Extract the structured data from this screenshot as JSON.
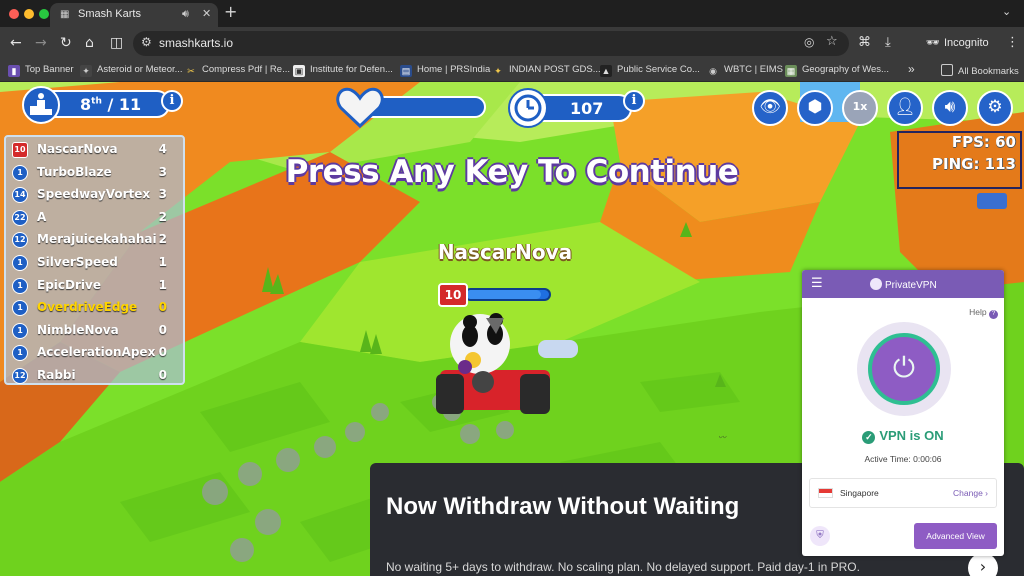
{
  "browser": {
    "tab": {
      "title": "Smash Karts"
    },
    "address": {
      "url": "smashkarts.io"
    },
    "profile": {
      "label": "Incognito"
    },
    "bookmarks": [
      "Top Banner",
      "Asteroid or Meteor...",
      "Compress Pdf | Re...",
      "Institute for Defen...",
      "Home | PRSIndia",
      "INDIAN POST GDS...",
      "Public Service Co...",
      "WBTC | EIMS",
      "Geography of Wes..."
    ],
    "overflow_label": "»",
    "all_bookmarks": "All Bookmarks"
  },
  "game": {
    "rank": {
      "value": "8",
      "suffix": "th",
      "total": "/ 11"
    },
    "timer": "107",
    "fps": "FPS: 60",
    "ping": "PING: 113",
    "speed_label": "1x",
    "prompt": "Press Any Key To Continue",
    "player_name": "NascarNova",
    "player_level": "10",
    "player_health": 0.9,
    "leaderboard": [
      {
        "level": "10",
        "name": "NascarNova",
        "score": "4",
        "badge": "red"
      },
      {
        "level": "1",
        "name": "TurboBlaze",
        "score": "3"
      },
      {
        "level": "14",
        "name": "SpeedwayVortex",
        "score": "3"
      },
      {
        "level": "22",
        "name": "A",
        "score": "2"
      },
      {
        "level": "12",
        "name": "Merajuicekahahai",
        "score": "2"
      },
      {
        "level": "1",
        "name": "SilverSpeed",
        "score": "1"
      },
      {
        "level": "1",
        "name": "EpicDrive",
        "score": "1"
      },
      {
        "level": "1",
        "name": "OverdriveEdge",
        "score": "0",
        "me": true
      },
      {
        "level": "1",
        "name": "NimbleNova",
        "score": "0"
      },
      {
        "level": "1",
        "name": "AccelerationApex",
        "score": "0"
      },
      {
        "level": "12",
        "name": "Rabbi",
        "score": "0"
      }
    ]
  },
  "promo": {
    "headline": "Now Withdraw Without Waiting",
    "sub": "No waiting 5+ days to withdraw. No scaling plan. No delayed support. Paid day-1 in PRO.",
    "arrow": "›"
  },
  "vpn": {
    "brand": "PrivateVPN",
    "help": "Help",
    "status": "VPN is ON",
    "active_time": "Active Time: 0:00:06",
    "location": "Singapore",
    "change": "Change",
    "advanced": "Advanced View"
  },
  "colors": {
    "hud_blue": "#1f5fc4",
    "vpn_purple": "#7a5bb5",
    "vpn_green": "#2a9c77",
    "highlight": "#ffd400"
  }
}
